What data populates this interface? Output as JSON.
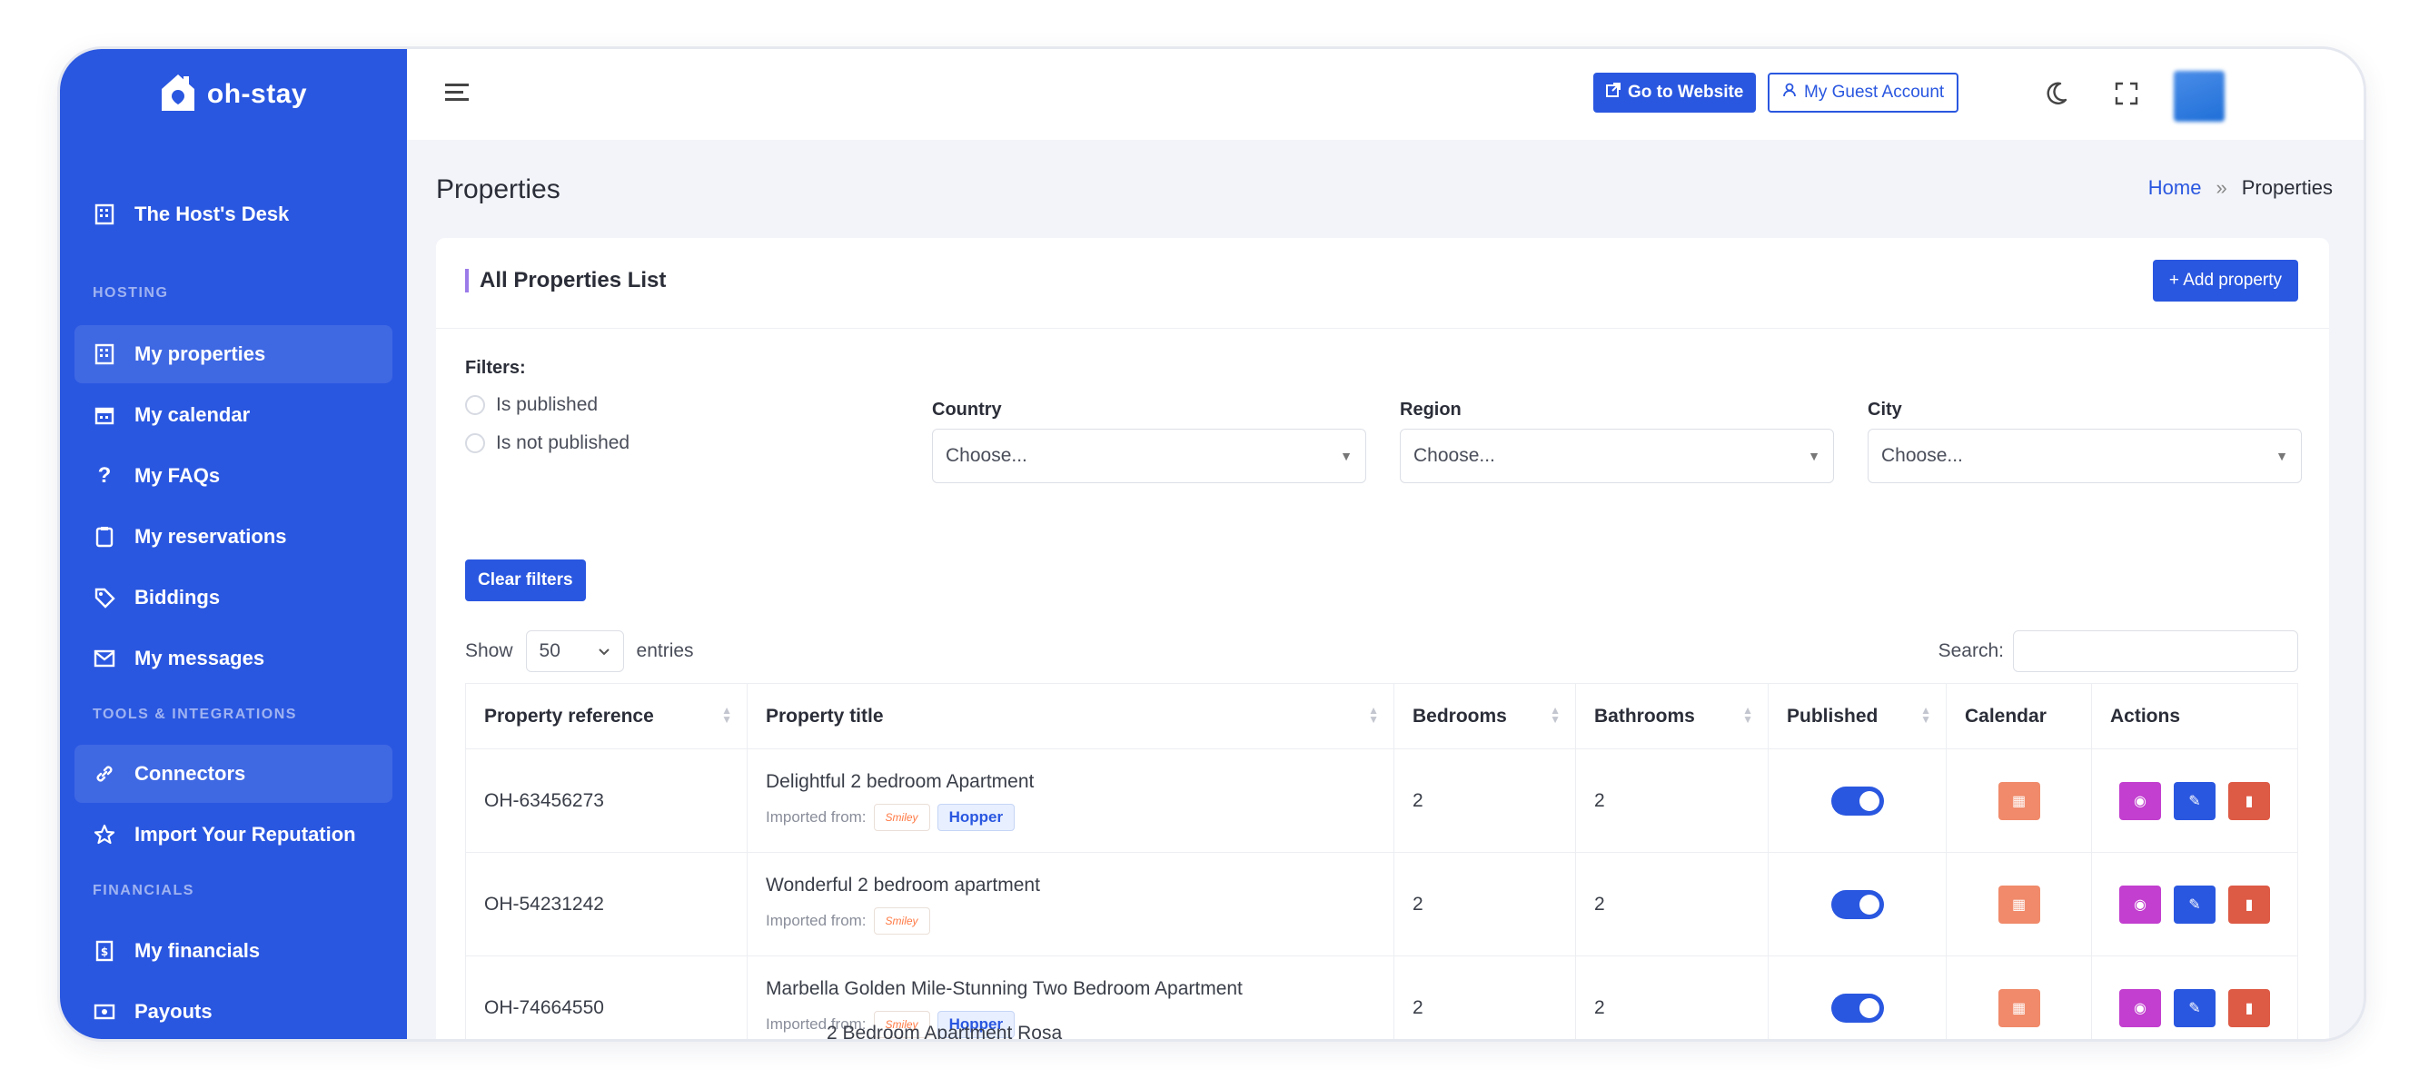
{
  "sidebar": {
    "logo": "oh-stay",
    "top_item": "The Host's Desk",
    "sections": [
      "HOSTING",
      "TOOLS & INTEGRATIONS",
      "FINANCIALS"
    ],
    "hosting_items": [
      "My properties",
      "My calendar",
      "My FAQs",
      "My reservations",
      "Biddings",
      "My messages"
    ],
    "tools_items": [
      "Connectors",
      "Import Your Reputation"
    ],
    "financial_items": [
      "My financials",
      "Payouts"
    ],
    "active_item": "My properties"
  },
  "topbar": {
    "website_label": "Go to Website",
    "guest_label": "My Guest Account"
  },
  "page": {
    "title": "Properties",
    "breadcrumb": [
      "Home",
      "»",
      "Properties"
    ]
  },
  "card": {
    "title": "All Properties List",
    "add_label": "+ Add property",
    "filters_label": "Filters:",
    "radio_published": "Is published",
    "radio_unpublished": "Is not published",
    "country_label": "Country",
    "region_label": "Region",
    "city_label": "City",
    "select_placeholder": "Choose...",
    "clear_label": "Clear filters",
    "show_label": "Show",
    "entries_value": "50",
    "entries_label": "entries",
    "search_label": "Search:"
  },
  "table": {
    "headers": [
      "Property reference",
      "Property title",
      "Bedrooms",
      "Bathrooms",
      "Published",
      "Calendar",
      "Actions"
    ],
    "imported_label": "Imported from:",
    "source_logo": "Smiley",
    "hopper_label": "Hopper",
    "rows": [
      {
        "ref": "OH-63456273",
        "title": "Delightful 2 bedroom Apartment",
        "bedrooms": "2",
        "bathrooms": "2",
        "hopper": true,
        "published": true
      },
      {
        "ref": "OH-54231242",
        "title": "Wonderful 2 bedroom apartment",
        "bedrooms": "2",
        "bathrooms": "2",
        "hopper": false,
        "published": true
      },
      {
        "ref": "OH-74664550",
        "title": "Marbella Golden Mile-Stunning Two Bedroom Apartment",
        "bedrooms": "2",
        "bathrooms": "2",
        "hopper": true,
        "published": true
      }
    ],
    "cut_row_title": "2 Bedroom Apartment Rosa"
  },
  "colors": {
    "brand_blue": "#2a57e0",
    "calendar_btn": "#f08a6a",
    "view_btn": "#c23fcf",
    "delete_btn": "#dd5a45"
  }
}
